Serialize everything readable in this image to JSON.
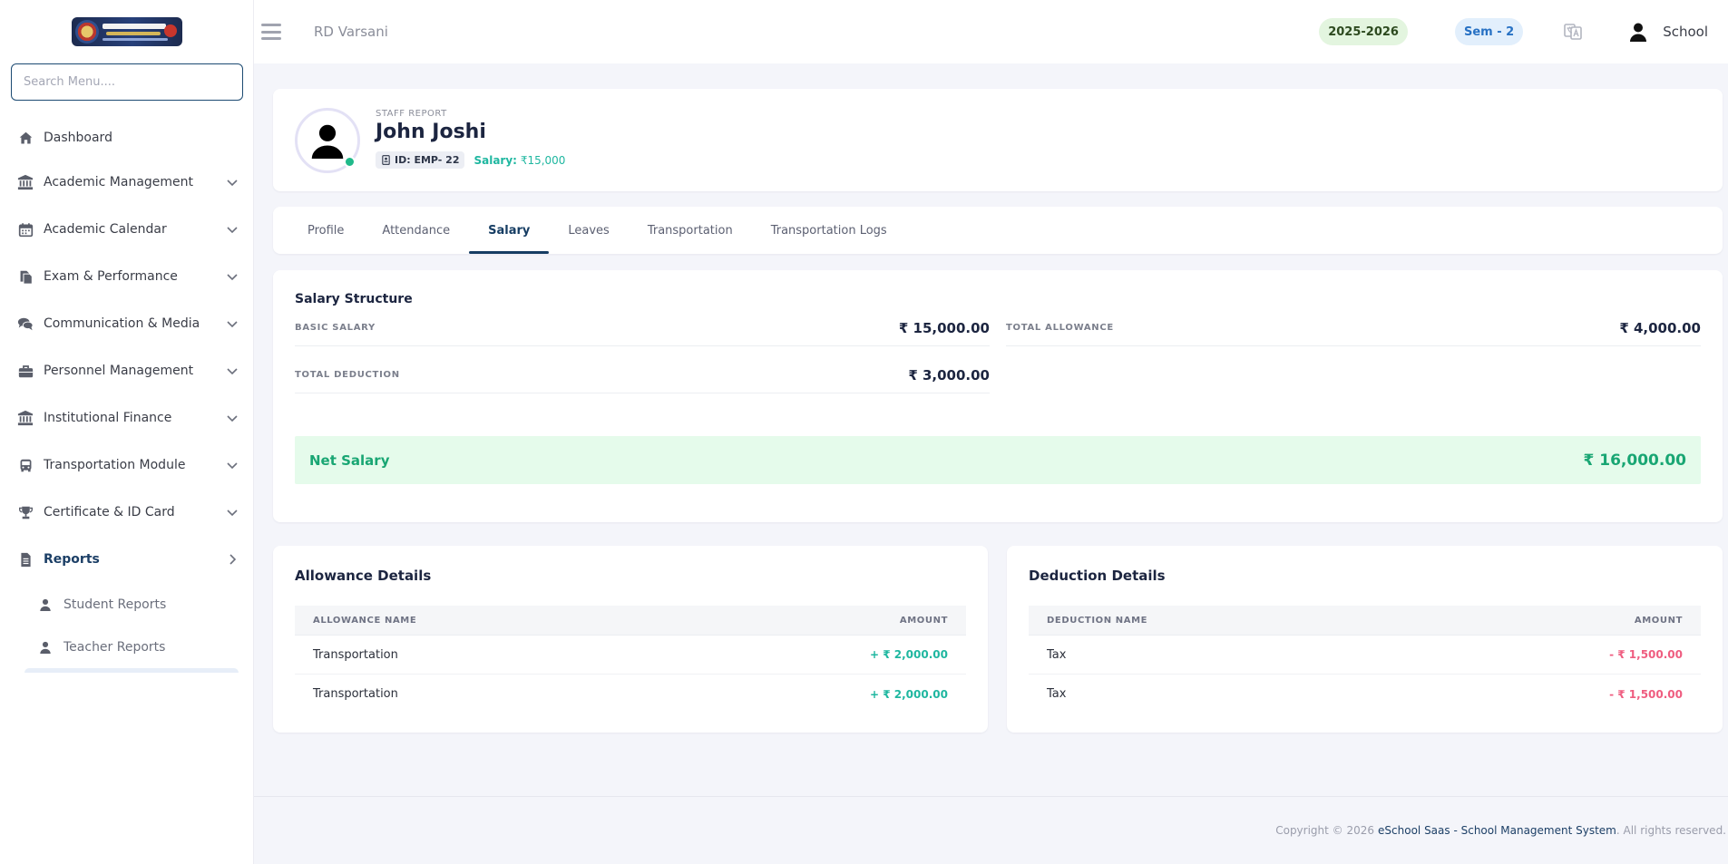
{
  "sidebar": {
    "search_placeholder": "Search Menu....",
    "items": [
      {
        "label": "Dashboard",
        "icon": "home-icon"
      },
      {
        "label": "Academic Management",
        "icon": "bank-icon"
      },
      {
        "label": "Academic Calendar",
        "icon": "calendar-icon"
      },
      {
        "label": "Exam & Performance",
        "icon": "copy-icon"
      },
      {
        "label": "Communication & Media",
        "icon": "comments-icon"
      },
      {
        "label": "Personnel Management",
        "icon": "briefcase-icon"
      },
      {
        "label": "Institutional Finance",
        "icon": "bank-icon"
      },
      {
        "label": "Transportation Module",
        "icon": "bus-icon"
      },
      {
        "label": "Certificate & ID Card",
        "icon": "trophy-icon"
      },
      {
        "label": "Reports",
        "icon": "file-icon"
      }
    ],
    "sub_items": [
      {
        "label": "Student Reports",
        "icon": "user-icon"
      },
      {
        "label": "Teacher Reports",
        "icon": "user-icon"
      }
    ]
  },
  "header": {
    "title": "RD Varsani",
    "session_year": "2025-2026",
    "semester": "Sem - 2",
    "user_label": "School"
  },
  "profile": {
    "tag": "STAFF REPORT",
    "name": "John Joshi",
    "id_badge": "ID: EMP- 22",
    "salary_label": "Salary:",
    "salary_value": "₹15,000"
  },
  "tabs": [
    {
      "label": "Profile",
      "active": false
    },
    {
      "label": "Attendance",
      "active": false
    },
    {
      "label": "Salary",
      "active": true
    },
    {
      "label": "Leaves",
      "active": false
    },
    {
      "label": "Transportation",
      "active": false
    },
    {
      "label": "Transportation Logs",
      "active": false
    }
  ],
  "salary_structure": {
    "title": "Salary Structure",
    "basic_label": "BASIC SALARY",
    "basic_value": "₹ 15,000.00",
    "allowance_label": "TOTAL ALLOWANCE",
    "allowance_value": "₹ 4,000.00",
    "deduction_label": "TOTAL DEDUCTION",
    "deduction_value": "₹ 3,000.00",
    "net_label": "Net Salary",
    "net_value": "₹ 16,000.00"
  },
  "allowance": {
    "title": "Allowance Details",
    "col_name": "ALLOWANCE NAME",
    "col_amount": "AMOUNT",
    "rows": [
      {
        "name": "Transportation",
        "amount": "+ ₹ 2,000.00"
      },
      {
        "name": "Transportation",
        "amount": "+ ₹ 2,000.00"
      }
    ]
  },
  "deduction": {
    "title": "Deduction Details",
    "col_name": "DEDUCTION NAME",
    "col_amount": "AMOUNT",
    "rows": [
      {
        "name": "Tax",
        "amount": "- ₹ 1,500.00"
      },
      {
        "name": "Tax",
        "amount": "- ₹ 1,500.00"
      }
    ]
  },
  "footer": {
    "prefix": "Copyright © 2026",
    "link": "eSchool Saas - School Management System",
    "suffix": ". All rights reserved."
  },
  "colors": {
    "primary": "#163d63",
    "success": "#19a673",
    "teal": "#1fb7a0",
    "danger": "#ef5d80"
  }
}
